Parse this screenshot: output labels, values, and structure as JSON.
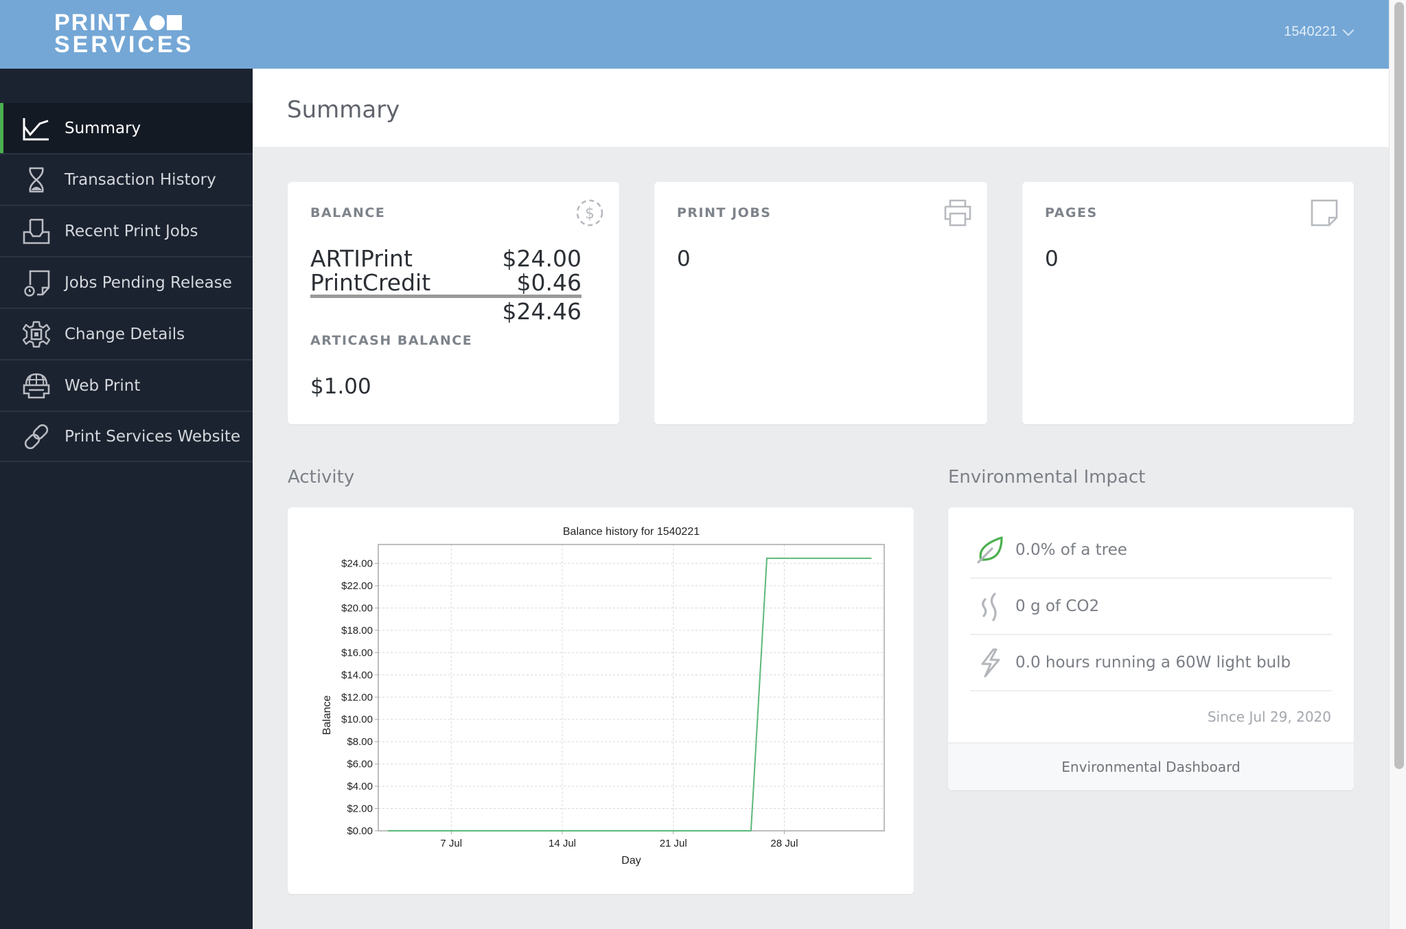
{
  "header": {
    "logo_line1": "PRINT",
    "logo_line2": "SERVICES",
    "user_id": "1540221"
  },
  "sidebar": {
    "items": [
      {
        "label": "Summary",
        "icon": "chart-line-icon",
        "active": true
      },
      {
        "label": "Transaction History",
        "icon": "hourglass-icon"
      },
      {
        "label": "Recent Print Jobs",
        "icon": "inbox-tray-icon"
      },
      {
        "label": "Jobs Pending Release",
        "icon": "page-clock-icon"
      },
      {
        "label": "Change Details",
        "icon": "gear-icon"
      },
      {
        "label": "Web Print",
        "icon": "globe-printer-icon"
      },
      {
        "label": "Print Services Website",
        "icon": "link-icon"
      }
    ]
  },
  "page": {
    "title": "Summary"
  },
  "cards": {
    "balance": {
      "label": "BALANCE",
      "icon": "dollar-circle-icon",
      "rows": [
        {
          "name": "ARTIPrint",
          "amount": "$24.00"
        },
        {
          "name": "PrintCredit",
          "amount": "$0.46"
        }
      ],
      "total": "$24.46",
      "articash_label": "ARTICASH BALANCE",
      "articash_value": "$1.00"
    },
    "print_jobs": {
      "label": "PRINT JOBS",
      "icon": "printer-icon",
      "value": "0"
    },
    "pages": {
      "label": "PAGES",
      "icon": "page-icon",
      "value": "0"
    }
  },
  "activity": {
    "title": "Activity"
  },
  "chart_data": {
    "type": "line",
    "title": "Balance history for 1540221",
    "xlabel": "Day",
    "ylabel": "Balance",
    "x_ticks": [
      {
        "day": 7,
        "label": "7 Jul"
      },
      {
        "day": 14,
        "label": "14 Jul"
      },
      {
        "day": 21,
        "label": "21 Jul"
      },
      {
        "day": 28,
        "label": "28 Jul"
      }
    ],
    "y_ticks": [
      "$0.00",
      "$2.00",
      "$4.00",
      "$6.00",
      "$8.00",
      "$10.00",
      "$12.00",
      "$14.00",
      "$16.00",
      "$18.00",
      "$20.00",
      "$22.00",
      "$24.00"
    ],
    "y_tick_values": [
      0,
      2,
      4,
      6,
      8,
      10,
      12,
      14,
      16,
      18,
      20,
      22,
      24
    ],
    "xlim_day_of_july": [
      2.4,
      34.3
    ],
    "ylim": [
      0,
      25.7
    ],
    "grid": true,
    "series": [
      {
        "name": "Balance",
        "color": "#5cb87a",
        "points": [
          {
            "day": 3.0,
            "value": 0.0
          },
          {
            "day": 25.9,
            "value": 0.0
          },
          {
            "day": 26.9,
            "value": 24.46
          },
          {
            "day": 33.5,
            "value": 24.46
          }
        ]
      }
    ]
  },
  "environment": {
    "title": "Environmental Impact",
    "items": [
      {
        "text": "0.0% of a tree",
        "icon": "leaf-icon"
      },
      {
        "text": "0 g of CO2",
        "icon": "smoke-icon"
      },
      {
        "text": "0.0 hours running a 60W light bulb",
        "icon": "lightning-icon"
      }
    ],
    "since": "Since Jul 29, 2020",
    "dashboard_link": "Environmental Dashboard"
  },
  "colors": {
    "header": "#74a7d6",
    "sidebar": "#1c2330",
    "active_indicator": "#4caf50",
    "chart_line": "#5cb87a",
    "leaf": "#4caf50"
  }
}
